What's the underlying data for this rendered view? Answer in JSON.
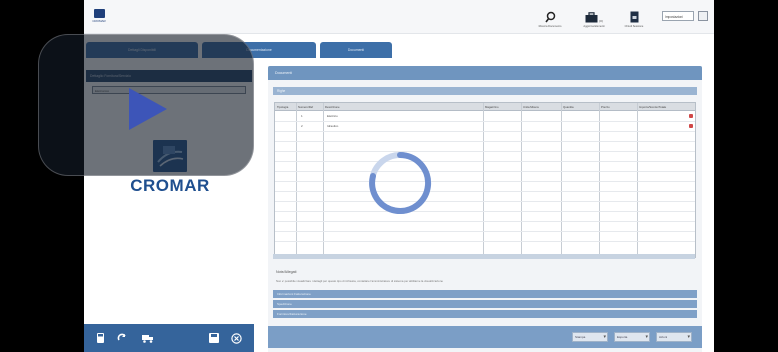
{
  "topbar": {
    "logo_text": "CROMAR",
    "actions": [
      {
        "label": "Ricerca Documento",
        "icon": "search-icon"
      },
      {
        "label": "Aggiorna Elementi",
        "icon": "briefcase-icon",
        "count": "(0)"
      },
      {
        "label": "Chiudi Sessione",
        "icon": "document-icon"
      }
    ],
    "language": "Impostazioni"
  },
  "tabs": [
    {
      "label": "Dettagli Disponibili"
    },
    {
      "label": "Documentazione"
    },
    {
      "label": "Documenti"
    }
  ],
  "left": {
    "panel_title": "Dettaglio Fornitura/Servizio",
    "field_value": "Elettronico",
    "brand_name": "CROMAR",
    "footer_icons": [
      "calculator-icon",
      "refresh-icon",
      "truck-icon",
      "save-icon",
      "close-icon"
    ]
  },
  "main": {
    "title": "Documenti",
    "section_title": "Righe",
    "columns": [
      "Tipologia",
      "Numero/Ref",
      "Descrizione",
      "Magazzino",
      "Unita Misura",
      "Quantita",
      "Prezzo",
      "Importo/Sconto/Totale"
    ],
    "rows": [
      {
        "num": "1",
        "desc": "Elettrico",
        "deletable": true
      },
      {
        "num": "2",
        "desc": "Idraulico",
        "deletable": true
      }
    ],
    "notes_label": "Note/Allegati",
    "notes_text": "Non e' possibile visualizzare i dettagli per questo tipo di richiesta, contattare l'amministratore di sistema per abilitarne la visualizzazione",
    "sections": [
      "Informazioni Fatturazione",
      "Spedizione",
      "Fornitore/Fatturazione"
    ],
    "footer_selects": [
      "Stampa",
      "Esporta",
      "Azioni"
    ]
  },
  "video": {
    "state": "loading"
  }
}
